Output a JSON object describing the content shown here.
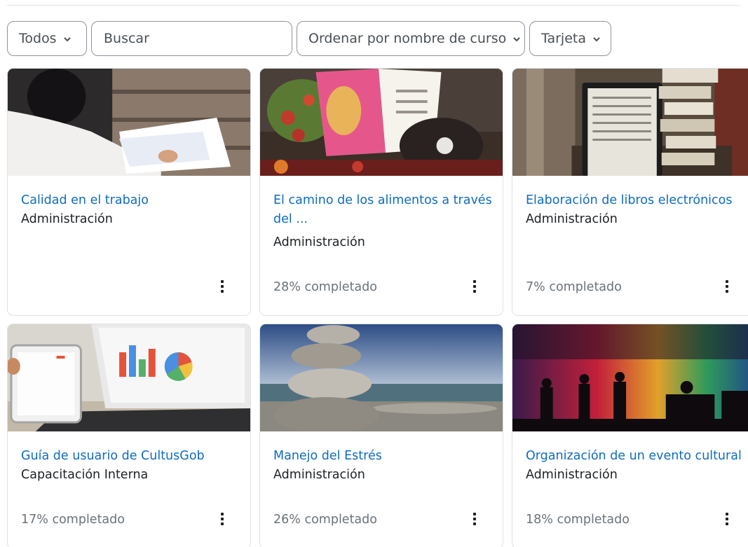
{
  "filters": {
    "status_label": "Todos",
    "search_placeholder": "Buscar",
    "sort_label": "Ordenar por nombre de curso",
    "view_label": "Tarjeta"
  },
  "courses": [
    {
      "title": "Calidad en el trabajo",
      "category": "Administración",
      "progress": "",
      "image_icon": "woman-writing-photo"
    },
    {
      "title": "El camino de los alimentos a través del ...",
      "category": "Administración",
      "progress": "28% completado",
      "image_icon": "food-magazine-photo"
    },
    {
      "title": "Elaboración de libros electrónicos",
      "category": "Administración",
      "progress": "7% completado",
      "image_icon": "ereader-books-photo"
    },
    {
      "title": "Guía de usuario de CultusGob",
      "category": "Capacitación Interna",
      "progress": "17% completado",
      "image_icon": "laptop-charts-photo"
    },
    {
      "title": "Manejo del Estrés",
      "category": "Administración",
      "progress": "26% completado",
      "image_icon": "stacked-stones-photo"
    },
    {
      "title": "Organización de un evento cultural",
      "category": "Administración",
      "progress": "18% completado",
      "image_icon": "concert-silhouette-photo"
    }
  ],
  "colors": {
    "link": "#0f6cbf",
    "text": "#1d2125",
    "muted": "#6a737b",
    "border": "#dee2e6"
  }
}
